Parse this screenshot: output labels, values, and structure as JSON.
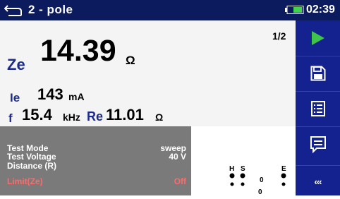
{
  "header": {
    "title": "2 - pole",
    "time": "02:39",
    "back_icon": "return-arrow-icon",
    "battery_icon": "battery-icon"
  },
  "page_indicator": "1/2",
  "results": {
    "ze": {
      "label": "Ze",
      "value": "14.39",
      "unit": "Ω"
    },
    "ie": {
      "label": "Ie",
      "value": "143",
      "unit": "mA"
    },
    "f": {
      "label": "f",
      "value": "15.4",
      "unit": "kHz"
    },
    "re": {
      "label": "Re",
      "value": "11.01",
      "unit": "Ω"
    }
  },
  "settings": {
    "test_mode": {
      "label": "Test Mode",
      "value": "sweep"
    },
    "test_voltage": {
      "label": "Test Voltage",
      "value": "40 V"
    },
    "distance": {
      "label": "Distance (R)",
      "value": ""
    },
    "limit": {
      "label": "Limit(Ze)",
      "value": "Off"
    }
  },
  "diagram": {
    "h": "H",
    "s": "S",
    "e": "E",
    "zero1": "0",
    "zero2": "0"
  },
  "sidebar": {
    "start_icon": "play-icon",
    "save_icon": "save-icon",
    "list_icon": "list-icon",
    "comment_icon": "comment-icon",
    "more_label": "‹‹‹"
  },
  "colors": {
    "header_bg": "#0c1a5e",
    "sidebar_bg": "#13228f",
    "label_blue": "#1d2c8c",
    "start_green": "#3fc34a",
    "limit_red": "#ff6a6a"
  }
}
